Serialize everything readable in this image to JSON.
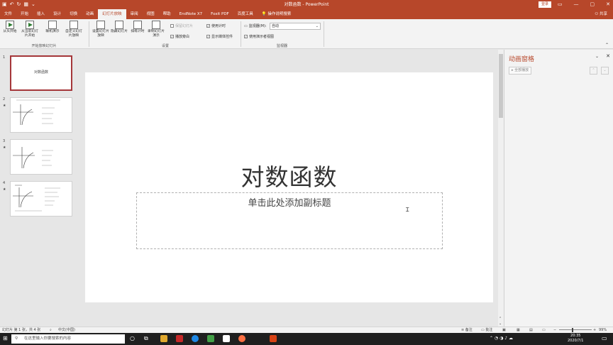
{
  "window": {
    "title": "对数函数  -  PowerPoint",
    "login_label": "登录",
    "qat_icons": [
      "save-icon",
      "undo-icon",
      "redo-icon",
      "start-from-beginning-icon",
      "customize-qat-icon"
    ],
    "controls": [
      "▭",
      "—",
      "▢",
      "✕"
    ]
  },
  "tabs": [
    "文件",
    "开始",
    "插入",
    "设计",
    "切换",
    "动画",
    "幻灯片放映",
    "审阅",
    "视图",
    "帮助",
    "EndNote X7",
    "Foxit PDF",
    "百度工具",
    "操作说明搜索"
  ],
  "active_tab_index": 6,
  "share_label": "共享",
  "ribbon": {
    "start": {
      "group": "开始放映幻灯片",
      "buttons": [
        "从头开始",
        "从当前幻灯片开始",
        "联机演示",
        "自定义幻灯片放映"
      ]
    },
    "setup": {
      "group": "设置",
      "buttons": [
        "设置幻灯片放映",
        "隐藏幻灯片",
        "排练计时",
        "录制幻灯片演示"
      ],
      "checks": [
        {
          "label": "播放旁白",
          "checked": true,
          "dim": false
        },
        {
          "label": "使用计时",
          "checked": true,
          "dim": false
        },
        {
          "label": "显示媒体控件",
          "checked": true,
          "dim": false
        },
        {
          "label": "保留幻灯片",
          "checked": false,
          "dim": true
        }
      ]
    },
    "monitor": {
      "group": "监视器",
      "label": "监视器(M):",
      "value": "自动",
      "presenter_view": "使用演示者视图"
    }
  },
  "thumbnails": [
    {
      "num": "1",
      "title": "对数函数",
      "star": false
    },
    {
      "num": "2",
      "title": "",
      "star": true
    },
    {
      "num": "3",
      "title": "",
      "star": true
    },
    {
      "num": "4",
      "title": "",
      "star": true
    }
  ],
  "slide": {
    "title": "对数函数",
    "subtitle_placeholder": "单击此处添加副标题"
  },
  "anim_pane": {
    "title": "动画窗格",
    "play_label": "全部播放"
  },
  "status": {
    "slide_info": "幻灯片 第 1 张，共 4 张",
    "lang": "中文(中国)",
    "notes": "备注",
    "comments": "批注",
    "zoom": "99%"
  },
  "taskbar": {
    "search_placeholder": "在这里输入你要搜索的内容",
    "time": "20:35",
    "date": "2020/7/1"
  }
}
